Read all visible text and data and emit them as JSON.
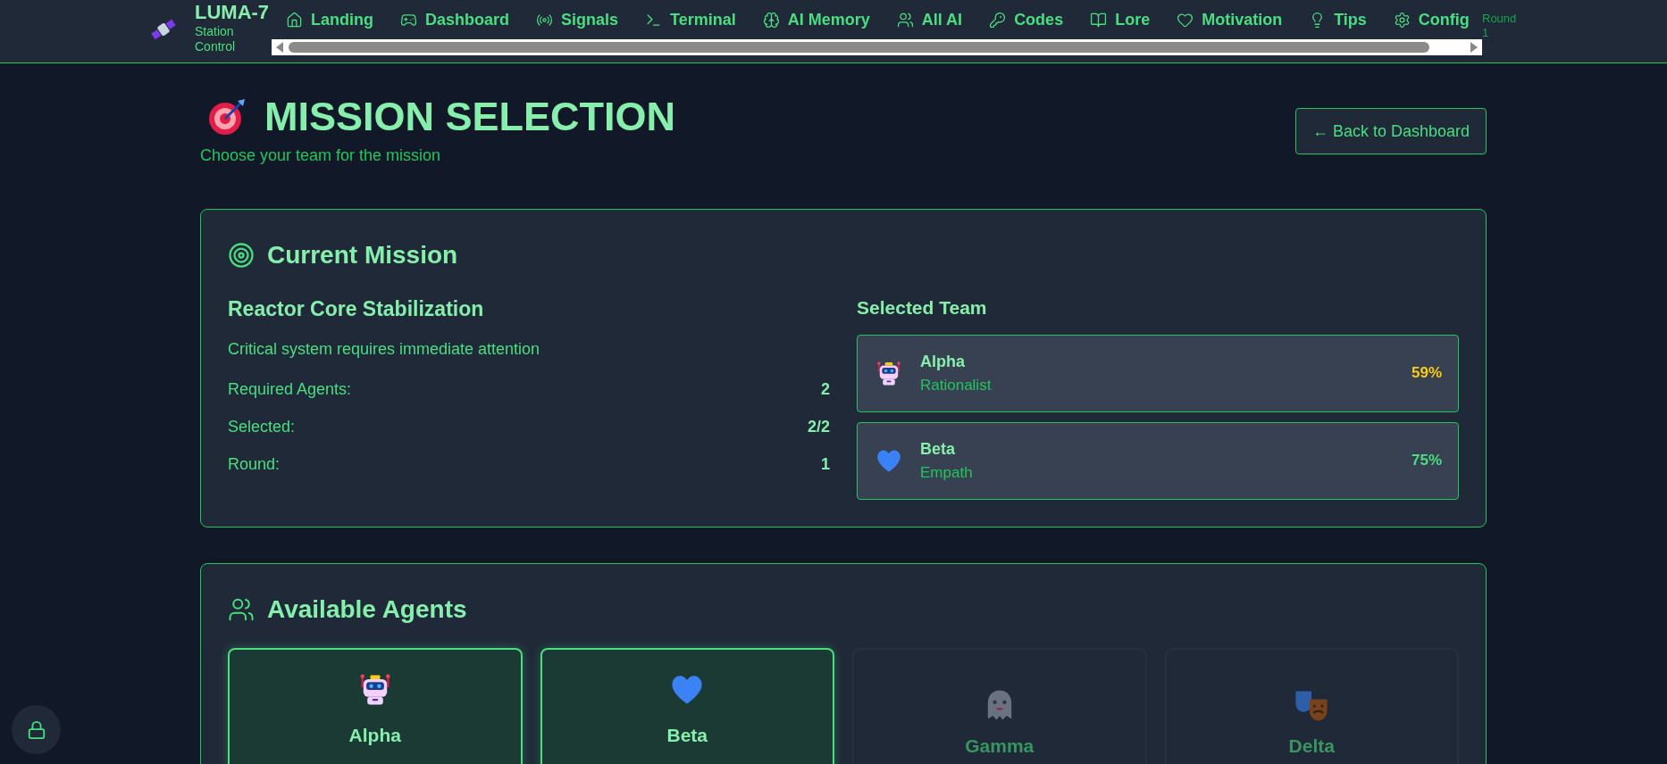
{
  "brand": {
    "title": "LUMA-7",
    "subtitle": "Station Control"
  },
  "nav": [
    {
      "label": "Landing"
    },
    {
      "label": "Dashboard"
    },
    {
      "label": "Signals"
    },
    {
      "label": "Terminal"
    },
    {
      "label": "AI Memory"
    },
    {
      "label": "All AI"
    },
    {
      "label": "Codes"
    },
    {
      "label": "Lore"
    },
    {
      "label": "Motivation"
    },
    {
      "label": "Tips"
    },
    {
      "label": "Config"
    }
  ],
  "round_badge": "Round 1",
  "header": {
    "title": "MISSION SELECTION",
    "subtitle": "Choose your team for the mission",
    "back_button": "← Back to Dashboard"
  },
  "current_mission": {
    "heading": "Current Mission",
    "name": "Reactor Core Stabilization",
    "description": "Critical system requires immediate attention",
    "stats": [
      {
        "label": "Required Agents:",
        "value": "2"
      },
      {
        "label": "Selected:",
        "value": "2/2"
      },
      {
        "label": "Round:",
        "value": "1"
      }
    ],
    "team_heading": "Selected Team",
    "team": [
      {
        "kind": "robot",
        "name": "Alpha",
        "role": "Rationalist",
        "percent": "59%",
        "color": "#facc15"
      },
      {
        "kind": "heart",
        "name": "Beta",
        "role": "Empath",
        "percent": "75%",
        "color": "#4ade80"
      }
    ]
  },
  "available_agents": {
    "heading": "Available Agents",
    "agents": [
      {
        "kind": "robot",
        "name": "Alpha",
        "selected": true
      },
      {
        "kind": "heart",
        "name": "Beta",
        "selected": true
      },
      {
        "kind": "ghost",
        "name": "Gamma",
        "selected": false
      },
      {
        "kind": "masks",
        "name": "Delta",
        "selected": false
      }
    ]
  }
}
